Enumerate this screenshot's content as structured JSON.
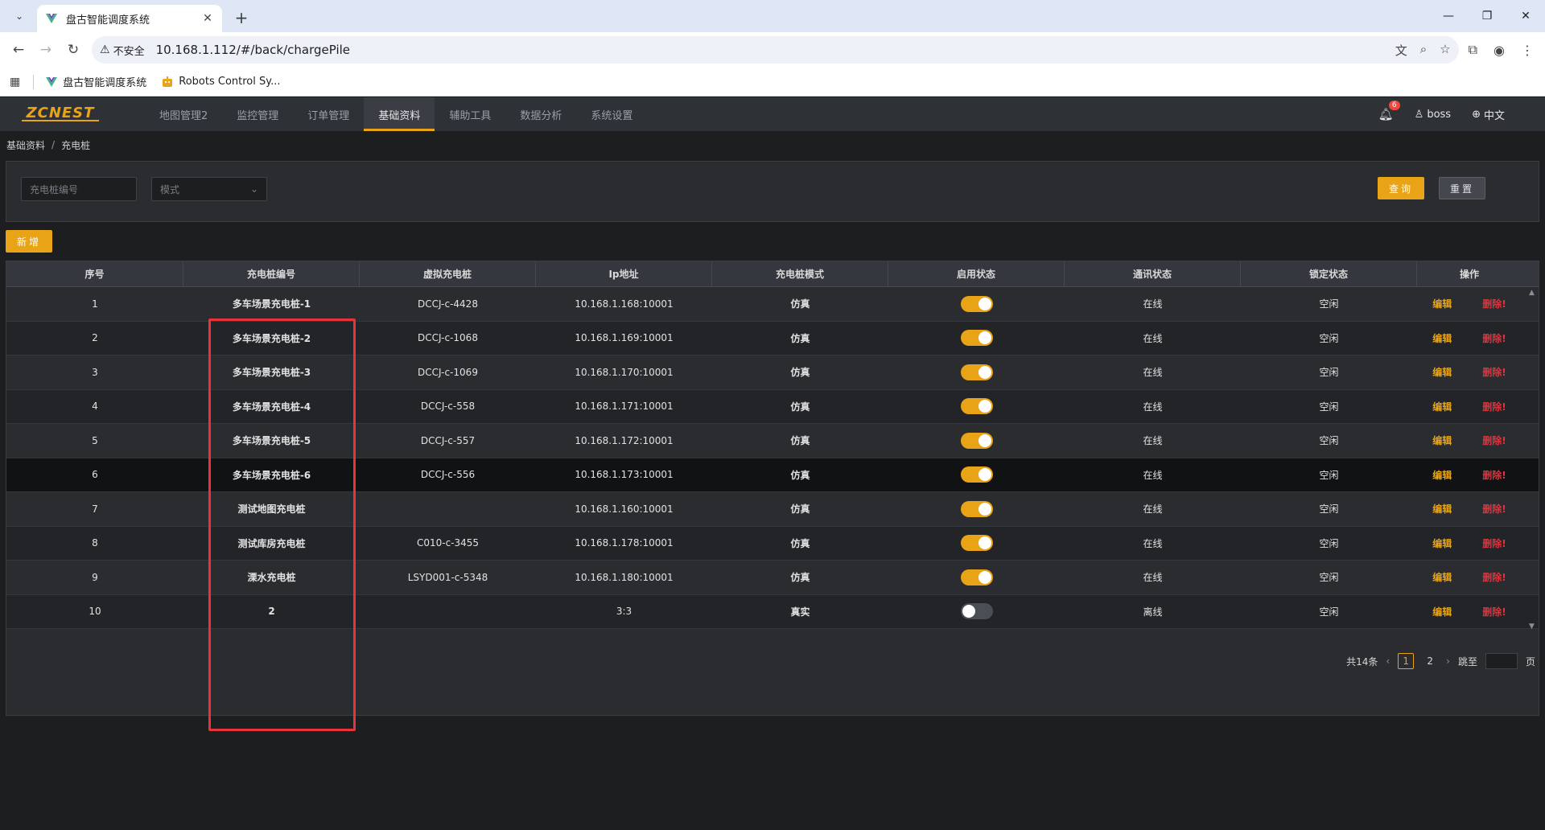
{
  "browser": {
    "tab_title": "盘古智能调度系统",
    "url": "10.168.1.112/#/back/chargePile",
    "security_label": "不安全",
    "bookmarks": [
      {
        "label": "盘古智能调度系统"
      },
      {
        "label": "Robots Control Sy..."
      }
    ]
  },
  "app": {
    "logo": "ZCNEST",
    "menu": [
      {
        "label": "地图管理2"
      },
      {
        "label": "监控管理"
      },
      {
        "label": "订单管理"
      },
      {
        "label": "基础资料",
        "active": true
      },
      {
        "label": "辅助工具"
      },
      {
        "label": "数据分析"
      },
      {
        "label": "系统设置"
      }
    ],
    "notification_count": "6",
    "user": "boss",
    "language": "中文",
    "accent_color": "#e8a317"
  },
  "breadcrumb": [
    "基础资料",
    "充电桩"
  ],
  "search": {
    "code_placeholder": "充电桩编号",
    "mode_placeholder": "模式",
    "query_label": "查询",
    "reset_label": "重置"
  },
  "add_label": "新增",
  "table": {
    "headers": [
      "序号",
      "充电桩编号",
      "虚拟充电桩",
      "Ip地址",
      "充电桩模式",
      "启用状态",
      "通讯状态",
      "锁定状态",
      "操作"
    ],
    "edit_label": "编辑",
    "delete_label": "删除!",
    "rows": [
      {
        "index": "1",
        "code": "多车场景充电桩-1",
        "virtual": "DCCJ-c-4428",
        "ip": "10.168.1.168:10001",
        "mode": "仿真",
        "enabled": true,
        "comm": "在线",
        "lock": "空闲"
      },
      {
        "index": "2",
        "code": "多车场景充电桩-2",
        "virtual": "DCCJ-c-1068",
        "ip": "10.168.1.169:10001",
        "mode": "仿真",
        "enabled": true,
        "comm": "在线",
        "lock": "空闲"
      },
      {
        "index": "3",
        "code": "多车场景充电桩-3",
        "virtual": "DCCJ-c-1069",
        "ip": "10.168.1.170:10001",
        "mode": "仿真",
        "enabled": true,
        "comm": "在线",
        "lock": "空闲"
      },
      {
        "index": "4",
        "code": "多车场景充电桩-4",
        "virtual": "DCCJ-c-558",
        "ip": "10.168.1.171:10001",
        "mode": "仿真",
        "enabled": true,
        "comm": "在线",
        "lock": "空闲"
      },
      {
        "index": "5",
        "code": "多车场景充电桩-5",
        "virtual": "DCCJ-c-557",
        "ip": "10.168.1.172:10001",
        "mode": "仿真",
        "enabled": true,
        "comm": "在线",
        "lock": "空闲"
      },
      {
        "index": "6",
        "code": "多车场景充电桩-6",
        "virtual": "DCCJ-c-556",
        "ip": "10.168.1.173:10001",
        "mode": "仿真",
        "enabled": true,
        "comm": "在线",
        "lock": "空闲"
      },
      {
        "index": "7",
        "code": "测试地图充电桩",
        "virtual": "",
        "ip": "10.168.1.160:10001",
        "mode": "仿真",
        "enabled": true,
        "comm": "在线",
        "lock": "空闲"
      },
      {
        "index": "8",
        "code": "测试库房充电桩",
        "virtual": "C010-c-3455",
        "ip": "10.168.1.178:10001",
        "mode": "仿真",
        "enabled": true,
        "comm": "在线",
        "lock": "空闲"
      },
      {
        "index": "9",
        "code": "溧水充电桩",
        "virtual": "LSYD001-c-5348",
        "ip": "10.168.1.180:10001",
        "mode": "仿真",
        "enabled": true,
        "comm": "在线",
        "lock": "空闲"
      },
      {
        "index": "10",
        "code": "2",
        "virtual": "",
        "ip": "3:3",
        "mode": "真实",
        "enabled": false,
        "comm": "离线",
        "lock": "空闲"
      }
    ]
  },
  "pagination": {
    "total": "共14条",
    "pages": [
      "1",
      "2"
    ],
    "current": "1",
    "jump_label": "跳至",
    "page_suffix": "页"
  },
  "icons": {
    "tab_menu": "chevron-down-icon",
    "favicon": "vue-logo-icon",
    "back": "arrow-left-icon",
    "forward": "arrow-right-icon",
    "reload": "reload-icon",
    "warning": "warning-icon",
    "translate": "translate-icon",
    "zoom": "zoom-icon",
    "star": "star-icon",
    "extensions": "puzzle-icon",
    "profile": "profile-icon",
    "more": "more-vert-icon",
    "bell": "bell-icon",
    "user": "user-icon",
    "globe": "globe-icon"
  }
}
